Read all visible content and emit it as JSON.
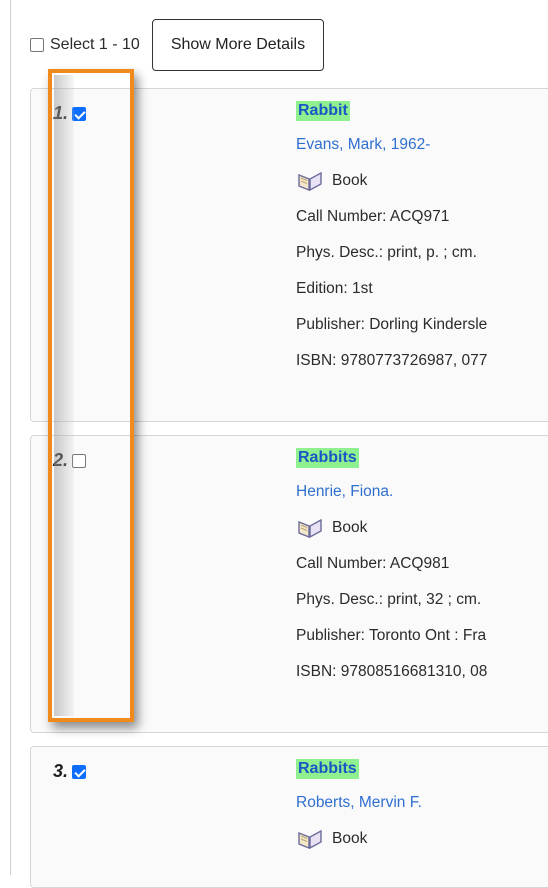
{
  "toolbar": {
    "select_label": "Select 1 - 10",
    "more_details_label": "Show More Details"
  },
  "results": [
    {
      "number": "1.",
      "checked": true,
      "title": "Rabbit",
      "author": "Evans, Mark, 1962-",
      "format": "Book",
      "lines": [
        "Call Number: ACQ971",
        "Phys. Desc.: print, p. ; cm.",
        "Edition: 1st",
        "Publisher: Dorling Kindersle",
        "ISBN: 9780773726987, 077"
      ]
    },
    {
      "number": "2.",
      "checked": false,
      "title": "Rabbits",
      "author": "Henrie, Fiona.",
      "format": "Book",
      "lines": [
        "Call Number: ACQ981",
        "Phys. Desc.: print, 32 ; cm.",
        "Publisher: Toronto Ont : Fra",
        "ISBN: 97808516681310, 08"
      ]
    },
    {
      "number": "3.",
      "checked": true,
      "title": "Rabbits",
      "author": "Roberts, Mervin F.",
      "format": "Book",
      "lines": []
    }
  ],
  "colors": {
    "highlight": "#f08a1c",
    "title_bg": "#8ef08e",
    "link": "#2f6fcf",
    "checkbox": "#0d6efd"
  },
  "icons": {
    "format": "open-book-icon"
  }
}
